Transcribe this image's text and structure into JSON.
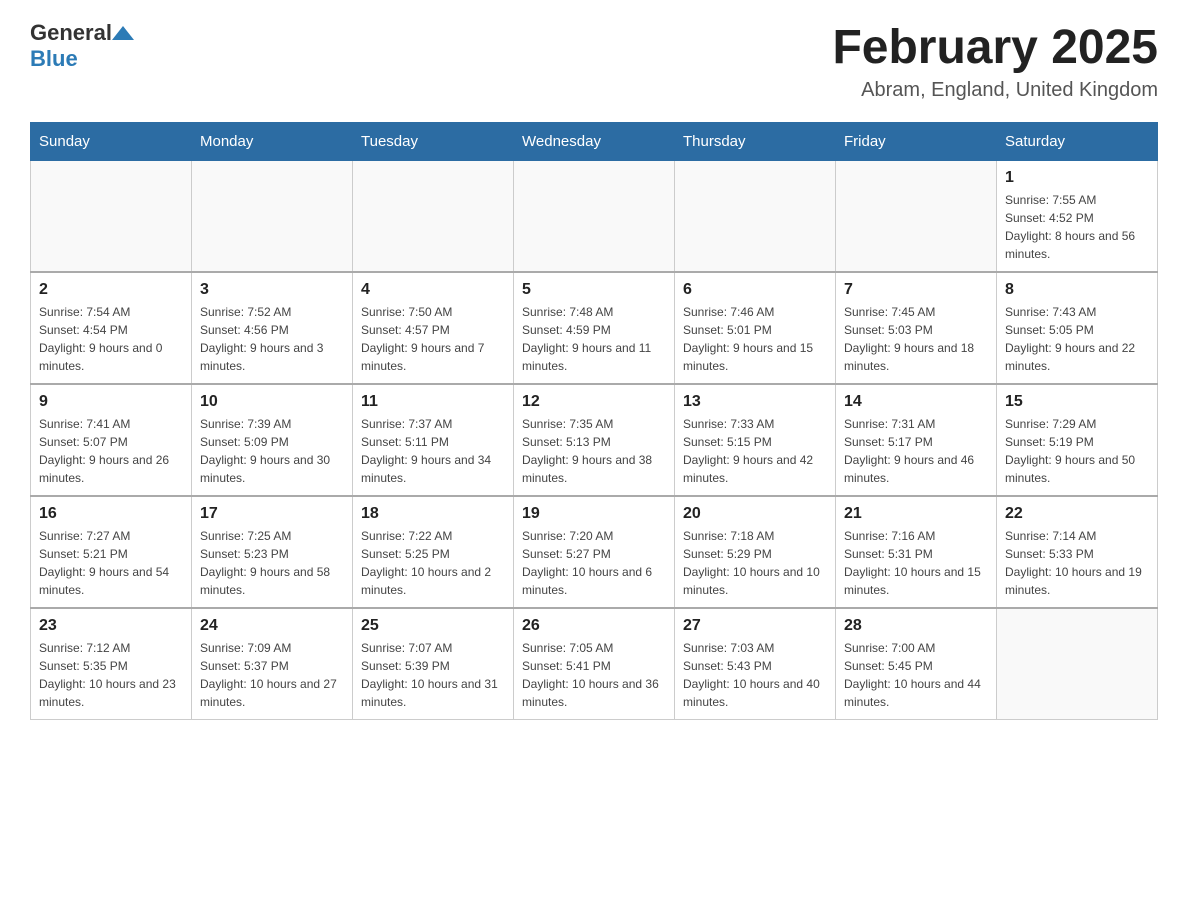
{
  "header": {
    "logo_general": "General",
    "logo_blue": "Blue",
    "month_title": "February 2025",
    "subtitle": "Abram, England, United Kingdom"
  },
  "weekdays": [
    "Sunday",
    "Monday",
    "Tuesday",
    "Wednesday",
    "Thursday",
    "Friday",
    "Saturday"
  ],
  "weeks": [
    [
      {
        "day": "",
        "info": ""
      },
      {
        "day": "",
        "info": ""
      },
      {
        "day": "",
        "info": ""
      },
      {
        "day": "",
        "info": ""
      },
      {
        "day": "",
        "info": ""
      },
      {
        "day": "",
        "info": ""
      },
      {
        "day": "1",
        "info": "Sunrise: 7:55 AM\nSunset: 4:52 PM\nDaylight: 8 hours and 56 minutes."
      }
    ],
    [
      {
        "day": "2",
        "info": "Sunrise: 7:54 AM\nSunset: 4:54 PM\nDaylight: 9 hours and 0 minutes."
      },
      {
        "day": "3",
        "info": "Sunrise: 7:52 AM\nSunset: 4:56 PM\nDaylight: 9 hours and 3 minutes."
      },
      {
        "day": "4",
        "info": "Sunrise: 7:50 AM\nSunset: 4:57 PM\nDaylight: 9 hours and 7 minutes."
      },
      {
        "day": "5",
        "info": "Sunrise: 7:48 AM\nSunset: 4:59 PM\nDaylight: 9 hours and 11 minutes."
      },
      {
        "day": "6",
        "info": "Sunrise: 7:46 AM\nSunset: 5:01 PM\nDaylight: 9 hours and 15 minutes."
      },
      {
        "day": "7",
        "info": "Sunrise: 7:45 AM\nSunset: 5:03 PM\nDaylight: 9 hours and 18 minutes."
      },
      {
        "day": "8",
        "info": "Sunrise: 7:43 AM\nSunset: 5:05 PM\nDaylight: 9 hours and 22 minutes."
      }
    ],
    [
      {
        "day": "9",
        "info": "Sunrise: 7:41 AM\nSunset: 5:07 PM\nDaylight: 9 hours and 26 minutes."
      },
      {
        "day": "10",
        "info": "Sunrise: 7:39 AM\nSunset: 5:09 PM\nDaylight: 9 hours and 30 minutes."
      },
      {
        "day": "11",
        "info": "Sunrise: 7:37 AM\nSunset: 5:11 PM\nDaylight: 9 hours and 34 minutes."
      },
      {
        "day": "12",
        "info": "Sunrise: 7:35 AM\nSunset: 5:13 PM\nDaylight: 9 hours and 38 minutes."
      },
      {
        "day": "13",
        "info": "Sunrise: 7:33 AM\nSunset: 5:15 PM\nDaylight: 9 hours and 42 minutes."
      },
      {
        "day": "14",
        "info": "Sunrise: 7:31 AM\nSunset: 5:17 PM\nDaylight: 9 hours and 46 minutes."
      },
      {
        "day": "15",
        "info": "Sunrise: 7:29 AM\nSunset: 5:19 PM\nDaylight: 9 hours and 50 minutes."
      }
    ],
    [
      {
        "day": "16",
        "info": "Sunrise: 7:27 AM\nSunset: 5:21 PM\nDaylight: 9 hours and 54 minutes."
      },
      {
        "day": "17",
        "info": "Sunrise: 7:25 AM\nSunset: 5:23 PM\nDaylight: 9 hours and 58 minutes."
      },
      {
        "day": "18",
        "info": "Sunrise: 7:22 AM\nSunset: 5:25 PM\nDaylight: 10 hours and 2 minutes."
      },
      {
        "day": "19",
        "info": "Sunrise: 7:20 AM\nSunset: 5:27 PM\nDaylight: 10 hours and 6 minutes."
      },
      {
        "day": "20",
        "info": "Sunrise: 7:18 AM\nSunset: 5:29 PM\nDaylight: 10 hours and 10 minutes."
      },
      {
        "day": "21",
        "info": "Sunrise: 7:16 AM\nSunset: 5:31 PM\nDaylight: 10 hours and 15 minutes."
      },
      {
        "day": "22",
        "info": "Sunrise: 7:14 AM\nSunset: 5:33 PM\nDaylight: 10 hours and 19 minutes."
      }
    ],
    [
      {
        "day": "23",
        "info": "Sunrise: 7:12 AM\nSunset: 5:35 PM\nDaylight: 10 hours and 23 minutes."
      },
      {
        "day": "24",
        "info": "Sunrise: 7:09 AM\nSunset: 5:37 PM\nDaylight: 10 hours and 27 minutes."
      },
      {
        "day": "25",
        "info": "Sunrise: 7:07 AM\nSunset: 5:39 PM\nDaylight: 10 hours and 31 minutes."
      },
      {
        "day": "26",
        "info": "Sunrise: 7:05 AM\nSunset: 5:41 PM\nDaylight: 10 hours and 36 minutes."
      },
      {
        "day": "27",
        "info": "Sunrise: 7:03 AM\nSunset: 5:43 PM\nDaylight: 10 hours and 40 minutes."
      },
      {
        "day": "28",
        "info": "Sunrise: 7:00 AM\nSunset: 5:45 PM\nDaylight: 10 hours and 44 minutes."
      },
      {
        "day": "",
        "info": ""
      }
    ]
  ]
}
